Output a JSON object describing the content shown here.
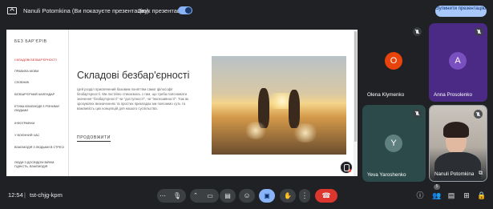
{
  "topbar": {
    "presenter_text": "Nanuli Potomkina (Ви показуєте презентацію)",
    "sound_label": "Звук презентації",
    "sound_on": true,
    "stop_button": "Зупинити презентацію"
  },
  "slide": {
    "sidebar_title": "БЕЗ БАР'ЄРІВ",
    "sidebar_items": [
      "СКЛАДОВІ БЕЗБАР'ЄРНОСТІ",
      "ПРАВИЛА МОВИ",
      "СЛОВНИК",
      "БЕЗБАР'ЄРНИЙ КАЛЕНДАР",
      "ЕТИКА ВЗАЄМОДІЇ З РІЗНИМИ ЛЮДЬМИ",
      "ІНФОГРАФІКИ",
      "У ВОЄННИЙ ЧАС",
      "ВЗАЄМОДІЯ З ЛЮДЬМИ В СТРЕСІ",
      "ЛЮДИ З ДОСВІДОМ ВІЙНИ: ГІДНІСТЬ, ВЗАЄМОДІЯ"
    ],
    "title": "Складові безбар'єрності",
    "body": "Цей розділ присвячений базовим поняттям самої філософії безбар'єрності. Ми постійно стикаємось з тим, що треба пояснювати значення \"безбар'єрності\" чи \"доступності\", чи \"інклюзивності\". Тож ак зрозумілих визначеннях та простих прикладах ми пояснимо суть та важливість цих концепцій для нашого суспільства.",
    "link": "ПРОДОВЖИТИ"
  },
  "participants": [
    {
      "name": "Olena Klymenko",
      "initial": "O",
      "tile_color": "#202124",
      "avatar_color": "#e8430b",
      "muted": true
    },
    {
      "name": "Anna Prosolenko",
      "initial": "A",
      "tile_color": "#4a2a85",
      "avatar_color": "#7a4fc0",
      "muted": true
    },
    {
      "name": "Yeva Yaroshenko",
      "initial": "Y",
      "tile_color": "#2c4a4a",
      "avatar_color": "#5f7f80",
      "muted": true
    },
    {
      "name": "Nanuli Potomkina",
      "initial": "",
      "tile_color": "#3a3a3a",
      "avatar_color": "",
      "muted": true
    }
  ],
  "bottombar": {
    "time": "12:54",
    "separator": "|",
    "meeting_code": "tst-chjg-kpm",
    "people_count": "5"
  },
  "icons": {
    "more": "more-horiz-icon",
    "mic": "mic-icon",
    "camera": "camera-icon",
    "captions": "captions-icon",
    "emoji": "emoji-icon",
    "present": "present-screen-icon",
    "hand": "raise-hand-icon",
    "options": "more-vert-icon",
    "end_call": "end-call-icon",
    "info": "info-icon",
    "people": "people-icon",
    "chat": "chat-icon",
    "activities": "activities-icon",
    "lock": "host-controls-icon"
  },
  "colors": {
    "background": "#202124",
    "accent": "#8ab4f8",
    "end_call": "#dc362e",
    "active_sidebar": "#c5221f"
  }
}
